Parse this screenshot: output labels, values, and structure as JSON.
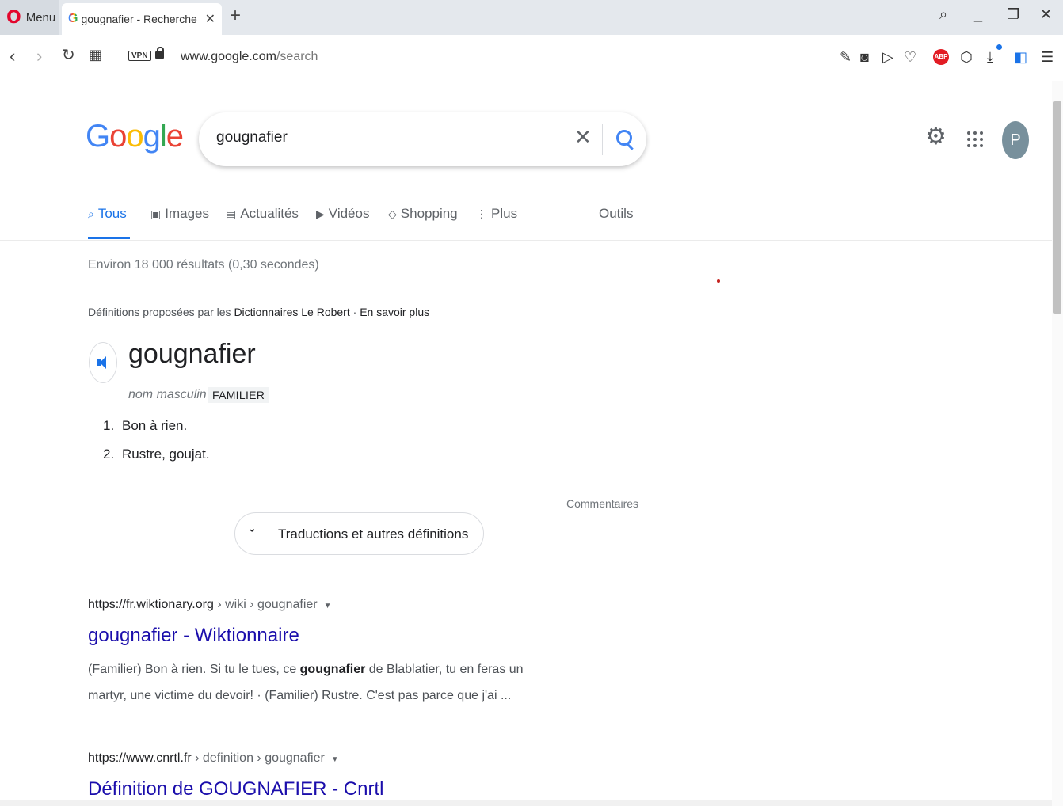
{
  "browser": {
    "menu_label": "Menu",
    "tab_title": "gougnafier - Recherche Go",
    "url_host": "www.google.com",
    "url_path": "/search",
    "vpn_label": "VPN",
    "abp_label": "ABP"
  },
  "google": {
    "logo": [
      "G",
      "o",
      "o",
      "g",
      "l",
      "e"
    ],
    "query": "gougnafier",
    "avatar_letter": "P",
    "tabs": [
      {
        "label": "Tous",
        "icon": "search-icon",
        "active": true
      },
      {
        "label": "Images",
        "icon": "image-icon"
      },
      {
        "label": "Actualités",
        "icon": "news-icon"
      },
      {
        "label": "Vidéos",
        "icon": "video-icon"
      },
      {
        "label": "Shopping",
        "icon": "tag-icon"
      },
      {
        "label": "Plus",
        "icon": "more-vert-icon"
      }
    ],
    "tools_label": "Outils",
    "stats": "Environ 18 000 résultats (0,30 secondes)"
  },
  "dictionary": {
    "source_prefix": "Définitions proposées par les",
    "source_link": "Dictionnaires Le Robert",
    "separator": "·",
    "learn_more": "En savoir plus",
    "word": "gougnafier",
    "part_of_speech": "nom masculin",
    "register": "FAMILIER",
    "definitions": [
      {
        "num": "1.",
        "text": "Bon à rien."
      },
      {
        "num": "2.",
        "text": "Rustre, goujat."
      }
    ],
    "feedback": "Commentaires",
    "expander_label": "Traductions et autres définitions"
  },
  "results": [
    {
      "cite_host": "https://fr.wiktionary.org",
      "cite_path": " › wiki › gougnafier",
      "title": "gougnafier - Wiktionnaire",
      "snippet_a": "(Familier) Bon à rien. Si tu le tues, ce ",
      "snippet_b": "gougnafier",
      "snippet_c": " de Blablatier, tu en feras un martyr, une victime du devoir! · (Familier) Rustre. C'est pas parce que j'ai ..."
    },
    {
      "cite_host": "https://www.cnrtl.fr",
      "cite_path": " › definition › gougnafier",
      "title": "Définition de GOUGNAFIER - Cnrtl"
    }
  ],
  "colors": {
    "link_blue": "#1a73e8",
    "result_title": "#1a0dab",
    "opera_red": "#e3062d"
  }
}
